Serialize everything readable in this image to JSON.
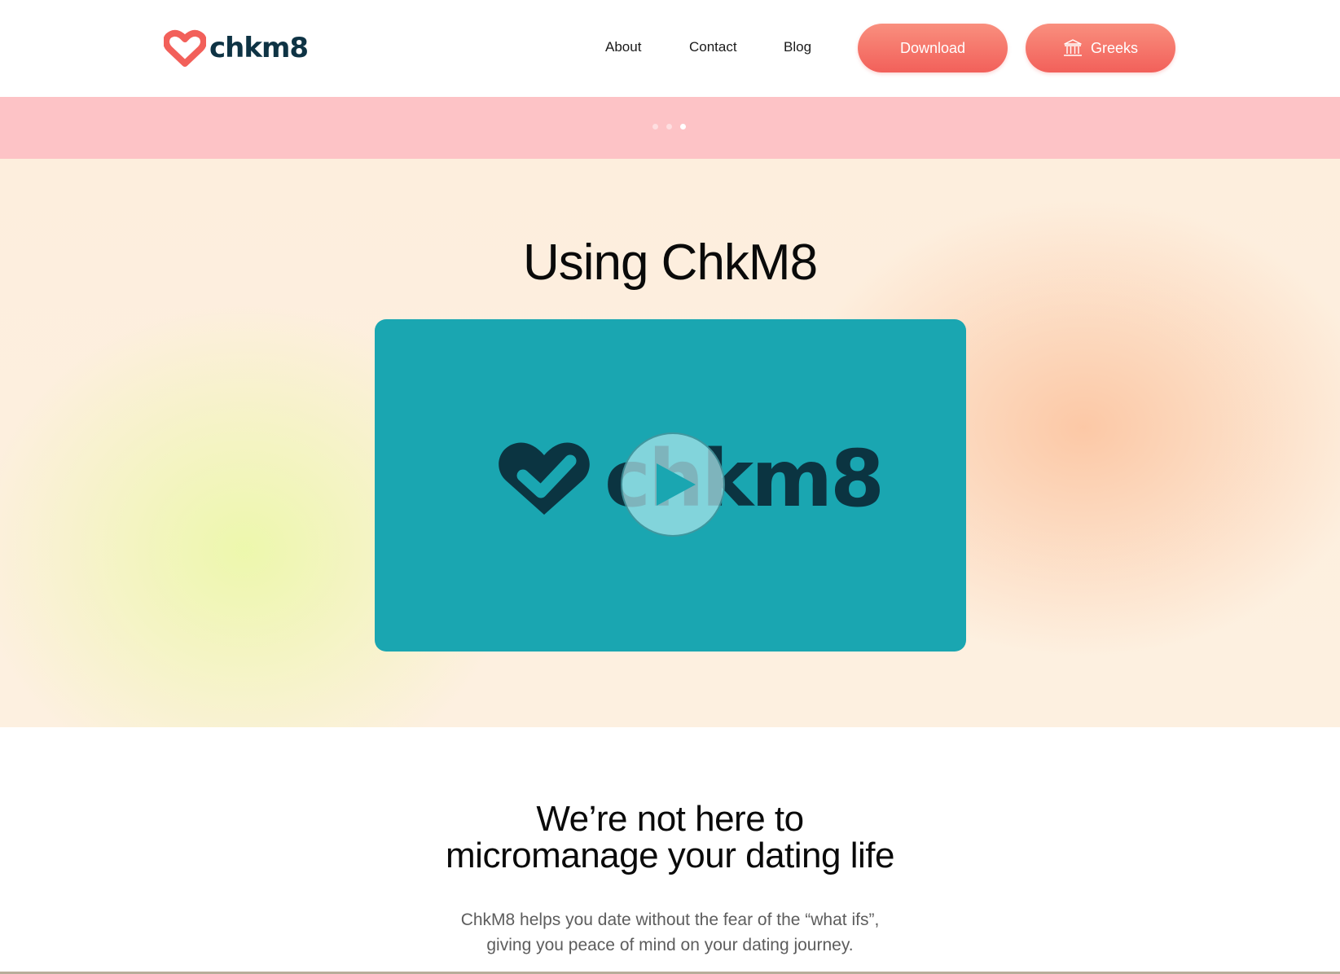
{
  "brand": {
    "name": "chkm8",
    "logo_icon": "heart-check-icon",
    "colors": {
      "coral": "#f2605a",
      "navy": "#0e3344",
      "teal": "#1aa6b1",
      "pink_strip": "#fdc3c6"
    }
  },
  "nav": {
    "about": "About",
    "contact": "Contact",
    "blog": "Blog"
  },
  "buttons": {
    "download": "Download",
    "greeks": "Greeks",
    "greeks_icon": "greek-column-icon"
  },
  "carousel": {
    "dot_count": 3,
    "active_index": 2
  },
  "hero": {
    "title": "Using ChkM8",
    "video": {
      "logo_text": "chkm8",
      "play_icon": "play-icon"
    }
  },
  "intro": {
    "title_line1": "We’re not here to",
    "title_line2": "micromanage your dating life",
    "text_line1": "ChkM8 helps you date without the fear of the “what ifs”,",
    "text_line2": "giving you peace of mind on your dating journey."
  }
}
